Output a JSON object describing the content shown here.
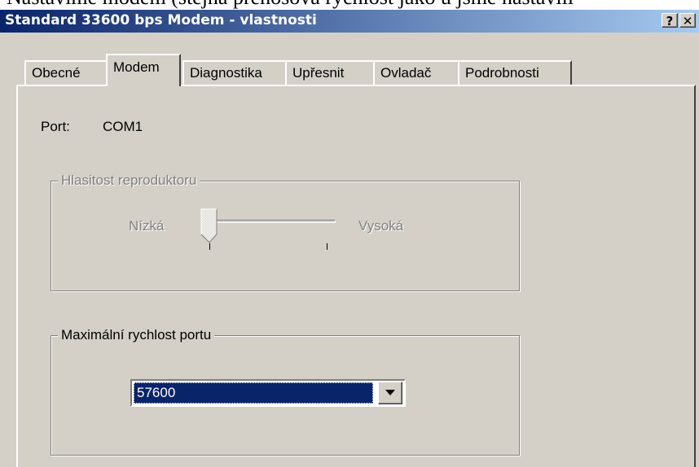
{
  "caption": "Nastavíme modem (stejná přenosová rychlost jako u jsme nastavili",
  "window": {
    "title": "Standard 33600 bps Modem - vlastnosti",
    "help_label": "?",
    "close_label": "✕"
  },
  "tabs": [
    {
      "label": "Obecné",
      "active": false
    },
    {
      "label": "Modem",
      "active": true
    },
    {
      "label": "Diagnostika",
      "active": false
    },
    {
      "label": "Upřesnit",
      "active": false
    },
    {
      "label": "Ovladač",
      "active": false
    },
    {
      "label": "Podrobnosti",
      "active": false
    }
  ],
  "port": {
    "label": "Port:",
    "value": "COM1"
  },
  "speaker_volume": {
    "legend": "Hlasitost reproduktoru",
    "low_label": "Nízká",
    "high_label": "Vysoká",
    "enabled": false,
    "level": 0
  },
  "max_speed": {
    "legend": "Maximální rychlost portu",
    "selected_value": "57600"
  },
  "colors": {
    "titlebar_start": "#0a246a",
    "titlebar_end": "#a6caf0",
    "face": "#d4d0c8",
    "selection": "#0a246a"
  }
}
